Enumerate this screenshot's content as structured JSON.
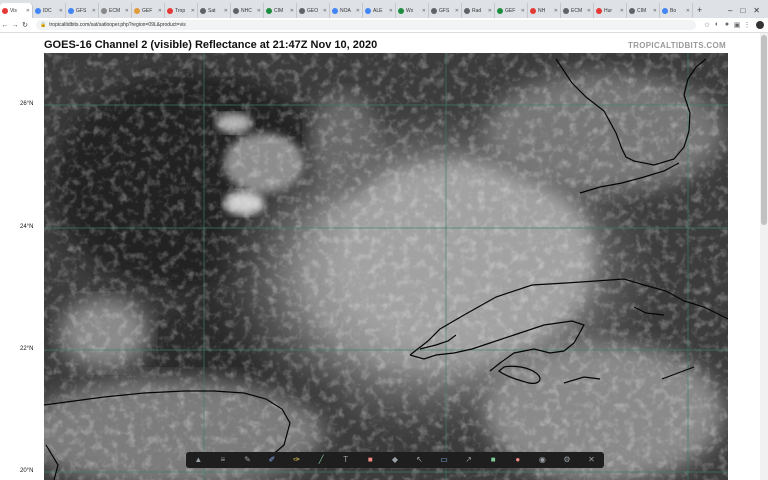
{
  "browser": {
    "tabs": [
      {
        "label": "Vis",
        "color": "#e53935",
        "active": true
      },
      {
        "label": "IDC",
        "color": "#4285f4"
      },
      {
        "label": "GFS",
        "color": "#4285f4"
      },
      {
        "label": "ECM",
        "color": "#888888"
      },
      {
        "label": "GEF",
        "color": "#e09b3d"
      },
      {
        "label": "Trop",
        "color": "#e53935"
      },
      {
        "label": "Sat",
        "color": "#5f6368"
      },
      {
        "label": "NHC",
        "color": "#5f6368"
      },
      {
        "label": "CIM",
        "color": "#1e8e3e"
      },
      {
        "label": "GEO",
        "color": "#5f6368"
      },
      {
        "label": "NOA",
        "color": "#4285f4"
      },
      {
        "label": "ALE",
        "color": "#4285f4"
      },
      {
        "label": "Wx",
        "color": "#1e8e3e"
      },
      {
        "label": "GFS",
        "color": "#5f6368"
      },
      {
        "label": "Rad",
        "color": "#5f6368"
      },
      {
        "label": "GEF",
        "color": "#1e8e3e"
      },
      {
        "label": "NH",
        "color": "#e53935"
      },
      {
        "label": "ECM",
        "color": "#5f6368"
      },
      {
        "label": "Hur",
        "color": "#e53935"
      },
      {
        "label": "CIM",
        "color": "#5f6368"
      },
      {
        "label": "Bo",
        "color": "#4285f4"
      }
    ],
    "new_tab": "+",
    "window": {
      "minimize": "–",
      "maximize": "□",
      "close": "✕"
    },
    "nav": {
      "back": "←",
      "forward": "→",
      "reload": "↻"
    },
    "url": "tropicaltidbits.com/sat/satlooper.php?region=09L&product=vis",
    "lock": "🔒",
    "extensions": [
      "☆",
      "◐",
      "●",
      "▣",
      "⋮"
    ]
  },
  "page": {
    "title": "GOES-16 Channel 2 (visible) Reflectance at 21:47Z Nov 10, 2020",
    "brand": "TROPICALTIDBITS.COM",
    "lat_labels": [
      "26°N",
      "24°N",
      "22°N",
      "20°N"
    ]
  },
  "toolbar": {
    "tools": [
      {
        "name": "pointer-tool",
        "glyph": "▲",
        "color": "#9aa0a6"
      },
      {
        "name": "layers-tool",
        "glyph": "≡",
        "color": "#9aa0a6"
      },
      {
        "name": "pen-tool",
        "glyph": "✎",
        "color": "#9aa0a6"
      },
      {
        "name": "highlighter-tool",
        "glyph": "✐",
        "color": "#8ab4f8"
      },
      {
        "name": "marker-tool",
        "glyph": "✑",
        "color": "#fdd663"
      },
      {
        "name": "line-tool",
        "glyph": "╱",
        "color": "#81c995"
      },
      {
        "name": "text-tool",
        "glyph": "T",
        "color": "#9aa0a6"
      },
      {
        "name": "shape-tool",
        "glyph": "■",
        "color": "#f28b82"
      },
      {
        "name": "eraser-tool",
        "glyph": "◆",
        "color": "#9aa0a6"
      },
      {
        "name": "select-tool",
        "glyph": "↖",
        "color": "#9aa0a6"
      },
      {
        "name": "screen-tool",
        "glyph": "▭",
        "color": "#8ab4f8"
      },
      {
        "name": "arrow-tool",
        "glyph": "↗",
        "color": "#9aa0a6"
      },
      {
        "name": "color-tool",
        "glyph": "■",
        "color": "#81c995"
      },
      {
        "name": "record-tool",
        "glyph": "●",
        "color": "#f28b82"
      },
      {
        "name": "camera-tool",
        "glyph": "◉",
        "color": "#9aa0a6"
      },
      {
        "name": "settings-tool",
        "glyph": "⚙",
        "color": "#9aa0a6"
      },
      {
        "name": "close-tool",
        "glyph": "✕",
        "color": "#9aa0a6"
      }
    ]
  }
}
